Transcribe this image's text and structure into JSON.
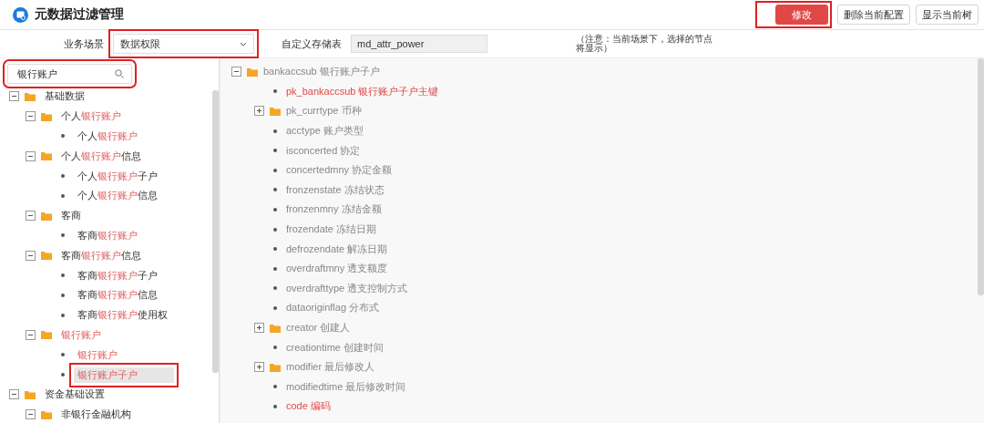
{
  "header": {
    "title": "元数据过滤管理",
    "buttons": [
      {
        "label": "修改",
        "kind": "primary",
        "annotated": true
      },
      {
        "label": "删除当前配置",
        "kind": "default"
      },
      {
        "label": "显示当前树",
        "kind": "default"
      }
    ]
  },
  "toolbar": {
    "scene": {
      "label": "业务场景",
      "value": "数据权限",
      "annotated": true
    },
    "table": {
      "label": "自定义存储表",
      "value": "md_attr_power"
    },
    "note": "（注意：当前场景下，选择的节点将显示）"
  },
  "search": {
    "value": "银行账户",
    "annotated": true
  },
  "left_tree": [
    {
      "kind": "folder",
      "expanded": true,
      "selected": false,
      "annotated": false,
      "segments": [
        {
          "text": "基础数据",
          "highlight": false
        }
      ],
      "children": [
        {
          "kind": "folder",
          "expanded": true,
          "selected": false,
          "annotated": false,
          "segments": [
            {
              "text": "个人",
              "highlight": false
            },
            {
              "text": "银行账户",
              "highlight": true
            }
          ],
          "children": [
            {
              "kind": "leaf",
              "selected": false,
              "annotated": false,
              "segments": [
                {
                  "text": "个人",
                  "highlight": false
                },
                {
                  "text": "银行账户",
                  "highlight": true
                }
              ]
            }
          ]
        },
        {
          "kind": "folder",
          "expanded": true,
          "selected": false,
          "annotated": false,
          "segments": [
            {
              "text": "个人",
              "highlight": false
            },
            {
              "text": "银行账户",
              "highlight": true
            },
            {
              "text": "信息",
              "highlight": false
            }
          ],
          "children": [
            {
              "kind": "leaf",
              "selected": false,
              "annotated": false,
              "segments": [
                {
                  "text": "个人",
                  "highlight": false
                },
                {
                  "text": "银行账户",
                  "highlight": true
                },
                {
                  "text": "子户",
                  "highlight": false
                }
              ]
            },
            {
              "kind": "leaf",
              "selected": false,
              "annotated": false,
              "segments": [
                {
                  "text": "个人",
                  "highlight": false
                },
                {
                  "text": "银行账户",
                  "highlight": true
                },
                {
                  "text": "信息",
                  "highlight": false
                }
              ]
            }
          ]
        },
        {
          "kind": "folder",
          "expanded": true,
          "selected": false,
          "annotated": false,
          "segments": [
            {
              "text": "客商",
              "highlight": false
            }
          ],
          "children": [
            {
              "kind": "leaf",
              "selected": false,
              "annotated": false,
              "segments": [
                {
                  "text": "客商",
                  "highlight": false
                },
                {
                  "text": "银行账户",
                  "highlight": true
                }
              ]
            }
          ]
        },
        {
          "kind": "folder",
          "expanded": true,
          "selected": false,
          "annotated": false,
          "segments": [
            {
              "text": "客商",
              "highlight": false
            },
            {
              "text": "银行账户",
              "highlight": true
            },
            {
              "text": "信息",
              "highlight": false
            }
          ],
          "children": [
            {
              "kind": "leaf",
              "selected": false,
              "annotated": false,
              "segments": [
                {
                  "text": "客商",
                  "highlight": false
                },
                {
                  "text": "银行账户",
                  "highlight": true
                },
                {
                  "text": "子户",
                  "highlight": false
                }
              ]
            },
            {
              "kind": "leaf",
              "selected": false,
              "annotated": false,
              "segments": [
                {
                  "text": "客商",
                  "highlight": false
                },
                {
                  "text": "银行账户",
                  "highlight": true
                },
                {
                  "text": "信息",
                  "highlight": false
                }
              ]
            },
            {
              "kind": "leaf",
              "selected": false,
              "annotated": false,
              "segments": [
                {
                  "text": "客商",
                  "highlight": false
                },
                {
                  "text": "银行账户",
                  "highlight": true
                },
                {
                  "text": "使用权",
                  "highlight": false
                }
              ]
            }
          ]
        },
        {
          "kind": "folder",
          "expanded": true,
          "selected": false,
          "annotated": false,
          "segments": [
            {
              "text": "银行账户",
              "highlight": true
            }
          ],
          "children": [
            {
              "kind": "leaf",
              "selected": false,
              "annotated": false,
              "segments": [
                {
                  "text": "银行账户",
                  "highlight": true
                }
              ]
            },
            {
              "kind": "leaf",
              "selected": true,
              "annotated": true,
              "segments": [
                {
                  "text": "银行账户子户",
                  "highlight": true
                }
              ]
            }
          ]
        }
      ]
    },
    {
      "kind": "folder",
      "expanded": true,
      "selected": false,
      "annotated": false,
      "segments": [
        {
          "text": "资金基础设置",
          "highlight": false
        }
      ],
      "children": [
        {
          "kind": "folder",
          "expanded": true,
          "selected": false,
          "annotated": false,
          "segments": [
            {
              "text": "非银行金融机构",
              "highlight": false
            }
          ]
        }
      ]
    }
  ],
  "right_tree": [
    {
      "kind": "folder",
      "expanded": true,
      "required": false,
      "label": "bankaccsub 银行账户子户",
      "children": [
        {
          "kind": "leaf",
          "required": true,
          "label": "pk_bankaccsub 银行账户子户主键"
        },
        {
          "kind": "folder",
          "expanded": false,
          "required": false,
          "label": "pk_currtype 币种"
        },
        {
          "kind": "leaf",
          "required": false,
          "label": "acctype 账户类型"
        },
        {
          "kind": "leaf",
          "required": false,
          "label": "isconcerted 协定"
        },
        {
          "kind": "leaf",
          "required": false,
          "label": "concertedmny 协定金额"
        },
        {
          "kind": "leaf",
          "required": false,
          "label": "fronzenstate 冻结状态"
        },
        {
          "kind": "leaf",
          "required": false,
          "label": "fronzenmny 冻结金额"
        },
        {
          "kind": "leaf",
          "required": false,
          "label": "frozendate 冻结日期"
        },
        {
          "kind": "leaf",
          "required": false,
          "label": "defrozendate 解冻日期"
        },
        {
          "kind": "leaf",
          "required": false,
          "label": "overdraftmny 透支额度"
        },
        {
          "kind": "leaf",
          "required": false,
          "label": "overdrafttype 透支控制方式"
        },
        {
          "kind": "leaf",
          "required": false,
          "label": "dataoriginflag 分布式"
        },
        {
          "kind": "folder",
          "expanded": false,
          "required": false,
          "label": "creator 创建人"
        },
        {
          "kind": "leaf",
          "required": false,
          "label": "creationtime 创建时间"
        },
        {
          "kind": "folder",
          "expanded": false,
          "required": false,
          "label": "modifier 最后修改人"
        },
        {
          "kind": "leaf",
          "required": false,
          "label": "modifiedtime 最后修改时间"
        },
        {
          "kind": "leaf",
          "required": true,
          "label": "code 编码"
        }
      ]
    }
  ]
}
